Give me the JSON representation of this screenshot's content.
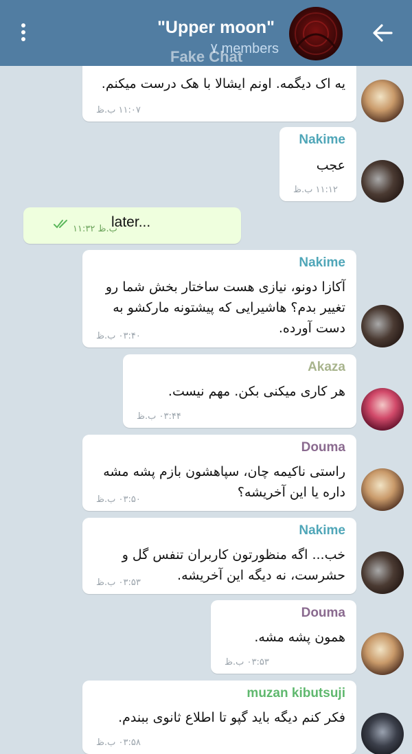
{
  "header": {
    "title": "\"Upper moon\"",
    "subtitle": "۷ members",
    "watermark": "Fake Chat",
    "colors": {
      "bar": "#517da2",
      "background": "#d5dfe6"
    }
  },
  "messages": [
    {
      "sender": "",
      "text": "یه اک دیگمه. اونم ایشالا با هک درست میکنم.",
      "time": "۱۱:۰۷ ب.ظ"
    },
    {
      "sender": "Nakime",
      "text": "عجب",
      "time": "۱۱:۱۲ ب.ظ"
    },
    {
      "text": "later...",
      "time": "۱۱:۳۲ ب.ظ"
    },
    {
      "sender": "Nakime",
      "lines": [
        "آکازا دونو، نیازی هست ساختار بخش شما رو",
        "تغییر بدم؟ هاشیرایی که پیشتونه مارکشو به",
        "دست آورده."
      ],
      "time": "۰۳:۴۰ ب.ظ"
    },
    {
      "sender": "Akaza",
      "text": "هر کاری میکنی بکن. مهم نیست.",
      "time": "۰۳:۴۴ ب.ظ"
    },
    {
      "sender": "Douma",
      "lines": [
        "راستی ناکیمه چان، سپاهشون بازم پشه مشه",
        "داره یا این آخریشه؟"
      ],
      "time": "۰۳:۵۰ ب.ظ"
    },
    {
      "sender": "Nakime",
      "lines": [
        "خب... اگه منظورتون کاربران تنفس گل و",
        "حشرست، نه دیگه این آخریشه."
      ],
      "time": "۰۳:۵۳ ب.ظ"
    },
    {
      "sender": "Douma",
      "text": "همون پشه مشه.",
      "time": "۰۳:۵۳ ب.ظ"
    },
    {
      "sender": "muzan kibutsuji",
      "text": "فکر کنم دیگه باید گپو تا اطلاع ثانوی ببندم.",
      "time": "۰۳:۵۸ ب.ظ"
    }
  ],
  "sender_colors": {
    "Nakime": "#4fa6b8",
    "Akaza": "#a8b48d",
    "Douma": "#8a6a8f",
    "muzan kibutsuji": "#5fb86e"
  }
}
